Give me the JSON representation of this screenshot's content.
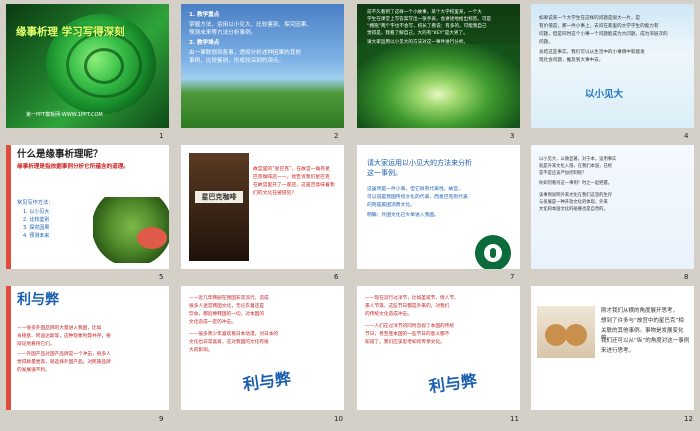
{
  "slides": [
    {
      "number": "1",
      "title": "缘事析理  学习写得深刻",
      "footer": "第一PPT模板网-WWW.1PPT.COM"
    },
    {
      "number": "2",
      "lines": [
        "1. 教学重点",
        "  掌握方法，运用以小见大、比较鉴别、探究因果、",
        "  预测未来等方法分析事例。",
        "2. 教学难点",
        "  由一事联想到各事，透彻分析述种因果的其他",
        "  事例，比较鉴别，形成较深刻的观点。"
      ]
    },
    {
      "number": "3",
      "lines": [
        "  前不久看到了这样一个小故事，某个大学校里某，一个大",
        "学生在课堂上写答案写出一张手表，会讲述地给出标签。可是",
        "“拥抱”两个字也不会写，校长了看说：有多的，可能我自己",
        "觉得是，我看了解自己，大的有“KEY”是大男了。",
        "  请大家运用以小见大的方法对这一事件进行分析。"
      ]
    },
    {
      "number": "4",
      "lines": [
        "  如果说某一个大学生在这样的问题是很大一片，是",
        "有价值是，那一件小事上，去问在家里的大学学生的能力有",
        "问题，但是同时这个小事一个问题能成为大问题，成为深层次的",
        "问题。",
        "  总结这些事实，我们可以从生活中的小事情中就能发",
        "现社会问题，推及到大事中去。"
      ],
      "highlight": "以小见大"
    },
    {
      "number": "5",
      "question": "什么是缘事析理呢？",
      "definition": "缘事析理是指依据事例分析它所蕴含的道理。",
      "methods_label": "常见写作方法：",
      "methods": [
        "1. 以小见大",
        "2. 比较鉴别",
        "3. 探究因果",
        "4. 预测未来"
      ]
    },
    {
      "number": "6",
      "sign": "星巴克咖啡",
      "lines": [
        "  故宫里的“星巴克”，在故宫一角有星",
        "巴克咖啡店——，他告诉我们星巴克",
        "在故宫里开了一家店，这是否意味着我",
        "们的文化在被侵犯？"
      ]
    },
    {
      "number": "7",
      "title_lines": [
        "请大家运用以小见大的方法来分析",
        "这一事例。"
      ],
      "body_lines": [
        "  这虽然是一件小事，但它很有代表性。故宫，",
        "可以说是我国传统文化的代表，而星巴克则代表",
        "的则是美国消费文化。",
        "  明确：外国文化已大举进入我国。"
      ]
    },
    {
      "number": "8",
      "lines": [
        "  以小见大，以微显著。对于本，运用事实",
        "就是外来文化入侵，在我们本国，已经",
        "是不是应该严加控制呢？",
        "  你如何看待这一事例？时之一起把握。",
        "  该事例说明外来文化在我们这里的生存",
        "与发展是一种开放文化的体现，外来",
        "文化和本国文化的碰撞也是自然的。"
      ]
    },
    {
      "number": "9",
      "heading": "利与弊",
      "lines": [
        "——很多外国品牌的大量进入我国，比如",
        "肯德基、阿迪达斯等，这种现象利弊共存，要",
        "辩证地看待它们。",
        "——外国产品对国产品牌是一个冲击，很多人",
        "觉得质量更高，就选择外国产品，对民族品牌",
        "的发展很不利。"
      ]
    },
    {
      "number": "10",
      "lines": [
        "——近几年韩剧在我国非常流行，造成",
        "很多人迷恋韩国文化，无论衣着还是",
        "饮食，都追捧韩国的一切，对本国的",
        "文化造成一定的冲击。",
        "——很多青少年喜欢看日本动漫，对日本的",
        "文化也非常喜爱，这对我国的文化有很",
        "大的影响。"
      ],
      "big": "利与弊"
    },
    {
      "number": "11",
      "lines": [
        "——现在流行过洋节，比如圣诞节、情人节、",
        "愚人节等，这些节日都是外来的，对我们",
        "的传统文化造成冲击。",
        "——人们在过洋节的同时忽视了本国的传统",
        "节日，甚至连本国的一些节日的意义都不",
        "知道了。我们应该思考如何传承文化。"
      ],
      "big": "利与弊"
    },
    {
      "number": "12",
      "lines": [
        "  刚才我们从横的角度展开思考，",
        "想到了许多与“故宫中的星巴克”相",
        "关联的其他事例。事物是发展变化的，",
        "我们还可以从“纵”的角度对这一事例",
        "来进行思考。"
      ]
    }
  ]
}
